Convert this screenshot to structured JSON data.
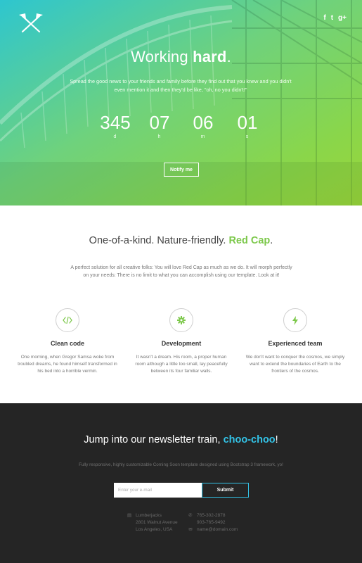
{
  "hero": {
    "social": [
      "f",
      "t",
      "g+"
    ],
    "title_light": "Working ",
    "title_bold": "hard",
    "title_dot": ".",
    "subtitle": "Spread the good news to your friends and family before they find out that you knew and you didn't even mention it and then they'd be like, \"oh, no you didn't!\"",
    "countdown": [
      {
        "value": "345",
        "unit": "d"
      },
      {
        "value": "07",
        "unit": "h"
      },
      {
        "value": "06",
        "unit": "m"
      },
      {
        "value": "01",
        "unit": "s"
      }
    ],
    "notify_label": "Notify me"
  },
  "features": {
    "title_light": "One-of-a-kind. Nature-friendly. ",
    "title_accent": "Red Cap",
    "title_dot": ".",
    "description": "A perfect solution for all creative folks: You will love Red Cap as much as we do. It will morph perfectly on your needs: There is no limit to what you can accomplish using our template. Look at it!",
    "items": [
      {
        "title": "Clean code",
        "icon": "code-icon",
        "text": "One morning, when Gregor Samsa woke from troubled dreams, he found himself transformed in his bed into a horrible vermin."
      },
      {
        "title": "Development",
        "icon": "gear-icon",
        "text": "It wasn't a dream. His room, a proper human room although a little too small, lay peacefully between its four familiar walls."
      },
      {
        "title": "Experienced team",
        "icon": "bolt-icon",
        "text": "We don't want to conquer the cosmos, we simply want to extend the boundaries of Earth to the frontiers of the cosmos."
      }
    ]
  },
  "newsletter": {
    "title_light": "Jump into our newsletter train, ",
    "title_accent": "choo-choo",
    "title_end": "!",
    "subtitle": "Fully responsive, highly customizable Coming Soon template designed using Bootstrap 3 framework, yo!",
    "email_placeholder": "Enter your e-mail",
    "submit_label": "Submit",
    "address": [
      "Lumberjacks",
      "2801 Walnut Avenue",
      "Los Angeles, USA"
    ],
    "phones": [
      "765-302-2878",
      "903-765-9492"
    ],
    "email": "name@domain.com"
  },
  "colors": {
    "hero_gradient_start": "#2ec6cf",
    "hero_gradient_end": "#9ad53a",
    "features_accent": "#7cc84a",
    "newsletter_accent": "#33c4e8",
    "newsletter_bg": "#252525"
  }
}
